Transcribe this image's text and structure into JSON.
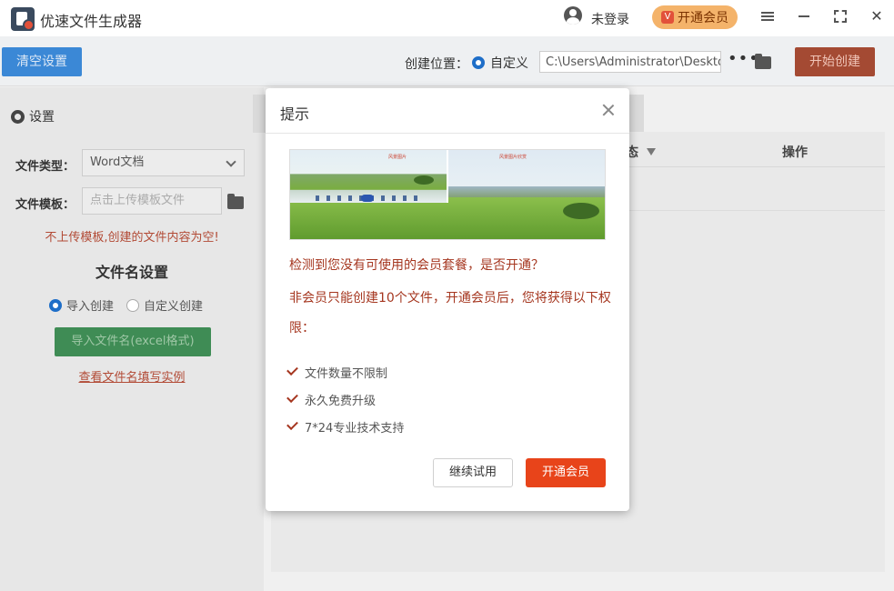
{
  "app": {
    "title": "优速文件生成器",
    "login_text": "未登录",
    "vip_label": "开通会员",
    "vip_icon_char": "V"
  },
  "toolbar": {
    "clear_label": "清空设置",
    "create_location_label": "创建位置：",
    "custom_option": "自定义",
    "path_value": "C:\\Users\\Administrator\\Desktop",
    "more_label": "•••",
    "start_label": "开始创建"
  },
  "left": {
    "settings_label": "设置",
    "file_type_label": "文件类型：",
    "file_type_value": "Word文档",
    "template_label": "文件模板：",
    "template_placeholder": "点击上传模板文件",
    "warning": "不上传模板,创建的文件内容为空!",
    "name_section_title": "文件名设置",
    "radio_import": "导入创建",
    "radio_custom": "自定义创建",
    "import_button": "导入文件名(excel格式)",
    "example_link": "查看文件名填写实例"
  },
  "table": {
    "status_header": "态",
    "action_header": "操作"
  },
  "dialog": {
    "title": "提示",
    "banner_tag_left": "风景图片",
    "banner_tag_right": "风景图片欣赏",
    "question": "检测到您没有可使用的会员套餐，是否开通？",
    "description": "非会员只能创建10个文件，开通会员后，您将获得以下权限：",
    "benefits": [
      "文件数量不限制",
      "永久免费升级",
      "7*24专业技术支持"
    ],
    "continue_label": "继续试用",
    "open_vip_label": "开通会员"
  },
  "colors": {
    "accent_blue": "#3b88d6",
    "accent_red": "#e8441a",
    "accent_green": "#3f8c55",
    "warning_red": "#a5361f"
  }
}
